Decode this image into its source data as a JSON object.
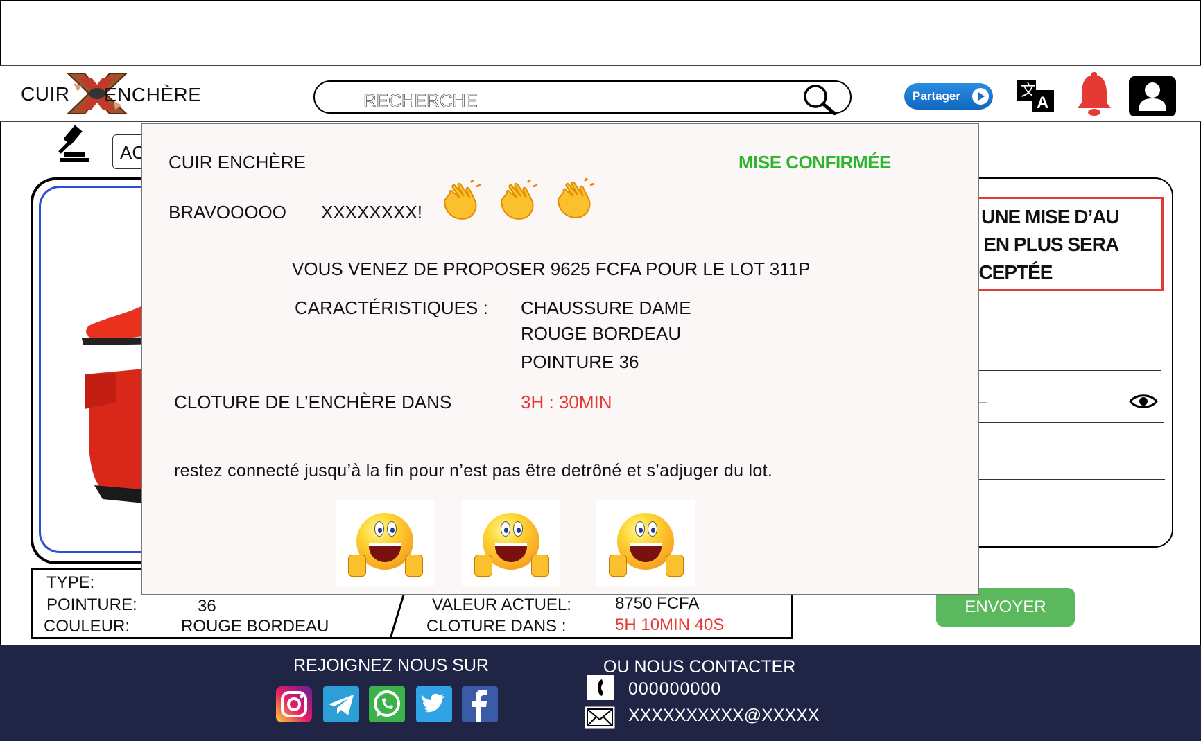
{
  "header": {
    "logo_left": "CUIR",
    "logo_right": "ENCHÈRE",
    "search_placeholder": "RECHERCHE",
    "share_label": "Partager"
  },
  "page": {
    "tab_label": "AC",
    "notice_lines": [
      "NT UNE MISE D’AU",
      "0% EN PLUS SERA",
      "ACCEPTÉE"
    ],
    "send_label": "ENVOYER"
  },
  "info": {
    "type_label": "TYPE:",
    "pointure_label": "POINTURE:",
    "pointure_value": "36",
    "couleur_label": "COULEUR:",
    "couleur_value": "ROUGE BORDEAU",
    "valeur_label": "VALEUR ACTUEL:",
    "valeur_value": "8750 FCFA",
    "cloture_label": "CLOTURE DANS :",
    "cloture_value": "5H 10MIN 40S"
  },
  "modal": {
    "brand": "CUIR ENCHÈRE",
    "status": "MISE CONFIRMÉE",
    "bravo": "BRAVOOOOO",
    "username": "XXXXXXXX!",
    "proposal": "VOUS VENEZ DE PROPOSER  9625 FCFA POUR LE LOT 311P",
    "caracteristiques_label": "CARACTÉRISTIQUES :",
    "caracteristiques": [
      "CHAUSSURE DAME",
      "ROUGE BORDEAU",
      "POINTURE 36"
    ],
    "closing_label": "CLOTURE DE L’ENCHÈRE DANS",
    "closing_value": "3H : 30MIN",
    "message": "restez connecté jusqu’à la fin pour  n’est pas être detrôné et s’adjuger du lot."
  },
  "footer": {
    "join_title": "REJOIGNEZ NOUS SUR",
    "contact_title": "OU NOUS CONTACTER",
    "phone": "000000000",
    "email": "XXXXXXXXXX@XXXXX",
    "social": [
      "instagram-icon",
      "telegram-icon",
      "whatsapp-icon",
      "twitter-icon",
      "facebook-icon"
    ]
  },
  "colors": {
    "status_green": "#2db52d",
    "alert_red": "#e53935",
    "footer_bg": "#202445",
    "send_green": "#5cb85c"
  }
}
